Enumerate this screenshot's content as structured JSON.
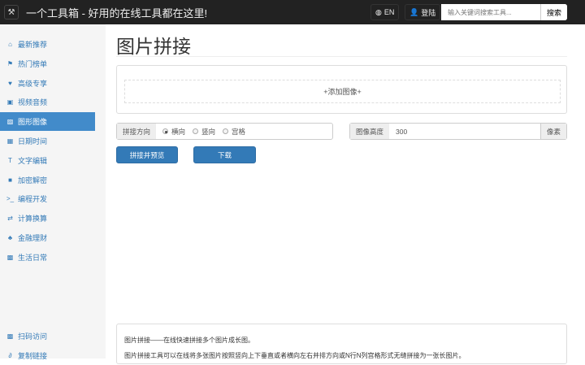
{
  "header": {
    "brand": "一个工具箱 - 好用的在线工具都在这里!",
    "lang": "EN",
    "login": "登陆",
    "search_placeholder": "输入关键词搜索工具...",
    "search_button": "搜索"
  },
  "sidebar": {
    "items": [
      {
        "label": "最新推荐",
        "icon": "⌂"
      },
      {
        "label": "热门榜单",
        "icon": "⚑"
      },
      {
        "label": "高级专享",
        "icon": "♥"
      },
      {
        "label": "视频音频",
        "icon": "▣"
      },
      {
        "label": "图形图像",
        "icon": "▨",
        "active": true
      },
      {
        "label": "日期时间",
        "icon": "▦"
      },
      {
        "label": "文字编辑",
        "icon": "T"
      },
      {
        "label": "加密解密",
        "icon": "■"
      },
      {
        "label": "编程开发",
        "icon": ">_"
      },
      {
        "label": "计算换算",
        "icon": "⇄"
      },
      {
        "label": "金融理财",
        "icon": "♣"
      },
      {
        "label": "生活日常",
        "icon": "▩"
      }
    ],
    "bottom": [
      {
        "label": "扫码访问",
        "icon": "▩"
      },
      {
        "label": "复制链接",
        "icon": "∂"
      }
    ]
  },
  "main": {
    "title": "图片拼接",
    "add_image": "+添加图像+",
    "direction_label": "拼接方向",
    "options": [
      "横向",
      "竖向",
      "宫格"
    ],
    "selected": "横向",
    "height_label": "图像高度",
    "height_value": "300",
    "height_unit": "像素",
    "preview_button": "拼接并预览",
    "download_button": "下载",
    "desc": [
      "图片拼接——在线快速拼接多个图片成长图。",
      "图片拼接工具可以在线将多张图片按照竖向上下垂直或者横向左右并排方向或N行N列宫格形式无缝拼接为一张长图片。"
    ]
  }
}
